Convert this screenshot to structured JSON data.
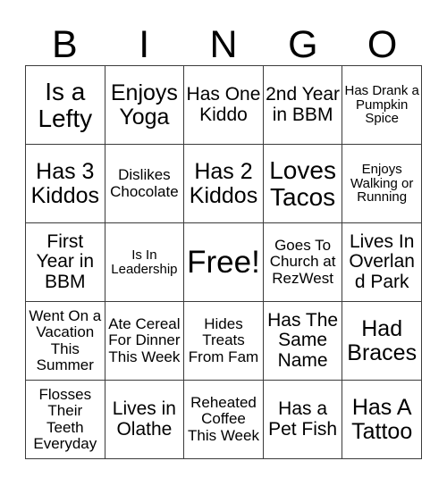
{
  "card": {
    "title_letters": [
      "B",
      "I",
      "N",
      "G",
      "O"
    ],
    "colors": {
      "background": "#ffffff",
      "grid_line": "#3b3b3b",
      "text": "#000000"
    },
    "rows": [
      [
        {
          "text": "Is a Lefty",
          "size": "fs-xl"
        },
        {
          "text": "Enjoys Yoga",
          "size": "fs-lg"
        },
        {
          "text": "Has One Kiddo",
          "size": "fs-md"
        },
        {
          "text": "2nd Year in BBM",
          "size": "fs-md"
        },
        {
          "text": "Has Drank a Pumpkin Spice",
          "size": "fs-xs"
        }
      ],
      [
        {
          "text": "Has 3 Kiddos",
          "size": "fs-lg"
        },
        {
          "text": "Dislikes Chocolate",
          "size": "fs-sm"
        },
        {
          "text": "Has 2 Kiddos",
          "size": "fs-lg"
        },
        {
          "text": "Loves Tacos",
          "size": "fs-xl"
        },
        {
          "text": "Enjoys Walking or Running",
          "size": "fs-xs"
        }
      ],
      [
        {
          "text": "First Year in BBM",
          "size": "fs-md"
        },
        {
          "text": "Is In Leadership",
          "size": "fs-xs"
        },
        {
          "text": "Free!",
          "size": "fs-xxl"
        },
        {
          "text": "Goes To Church at RezWest",
          "size": "fs-sm"
        },
        {
          "text": "Lives In Overland Park",
          "size": "fs-md"
        }
      ],
      [
        {
          "text": "Went On a Vacation This Summer",
          "size": "fs-sm"
        },
        {
          "text": "Ate Cereal For Dinner This Week",
          "size": "fs-sm"
        },
        {
          "text": "Hides Treats From Fam",
          "size": "fs-sm"
        },
        {
          "text": "Has The Same Name",
          "size": "fs-md"
        },
        {
          "text": "Had Braces",
          "size": "fs-lg"
        }
      ],
      [
        {
          "text": "Flosses Their Teeth Everyday",
          "size": "fs-sm"
        },
        {
          "text": "Lives in Olathe",
          "size": "fs-md"
        },
        {
          "text": "Reheated Coffee This Week",
          "size": "fs-sm"
        },
        {
          "text": "Has a Pet Fish",
          "size": "fs-md"
        },
        {
          "text": "Has A Tattoo",
          "size": "fs-lg"
        }
      ]
    ]
  }
}
